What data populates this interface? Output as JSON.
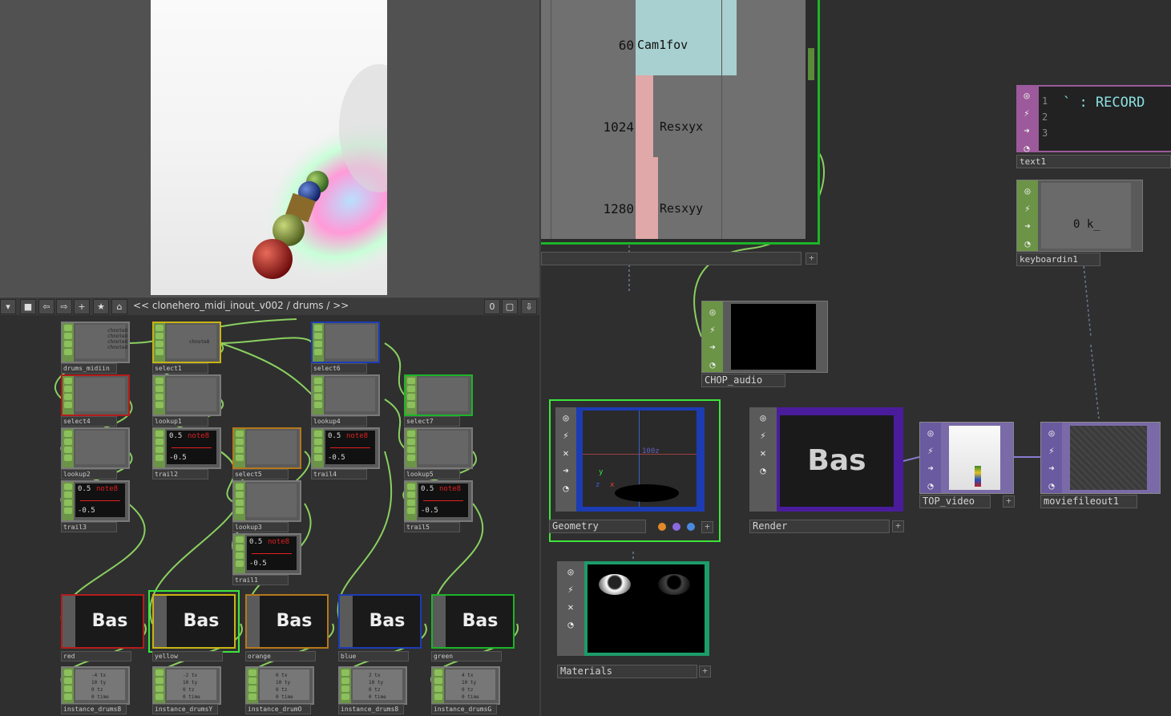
{
  "viewer": {
    "label": "render preview"
  },
  "toolbar": {
    "path": "<<  clonehero_midi_inout_v002 / drums / >>",
    "counter": "0",
    "buttons": [
      "▾",
      "■",
      "⇦",
      "⇨",
      "+",
      "★",
      "⌂"
    ]
  },
  "table": {
    "rows": [
      {
        "value": "60",
        "name": "Cam1fov"
      },
      {
        "value": "1024",
        "name": "Resxyx"
      },
      {
        "value": "1280",
        "name": "Resxyy"
      }
    ]
  },
  "left_nodes": {
    "drums_midiin": "drums_midiin",
    "select1": "select1",
    "select6": "select6",
    "select4": "select4",
    "lookup1": "lookup1",
    "lookup4": "lookup4",
    "select7": "select7",
    "lookup2": "lookup2",
    "trail2": "trail2",
    "select5": "select5",
    "trail4": "trail4",
    "lookup5": "lookup5",
    "trail3": "trail3",
    "lookup3": "lookup3",
    "trail5": "trail5",
    "trail1": "trail1",
    "chnote": "chnote8",
    "note_label": "note8",
    "trail_top": "0.5",
    "trail_mid": "0",
    "trail_bot": "-0.5"
  },
  "bas_nodes": [
    {
      "label": "red",
      "text": "Bas",
      "color": "#b41c1c"
    },
    {
      "label": "yellow",
      "text": "Bas",
      "color": "#c8b414"
    },
    {
      "label": "orange",
      "text": "Bas",
      "color": "#b4781c"
    },
    {
      "label": "blue",
      "text": "Bas",
      "color": "#1c3cb4"
    },
    {
      "label": "green",
      "text": "Bas",
      "color": "#1cb428"
    }
  ],
  "instance_nodes": [
    {
      "label": "instance_drums8",
      "tx": "-4",
      "ty": "10",
      "tz": "0",
      "time": "0"
    },
    {
      "label": "instance_drumsY",
      "tx": "-2",
      "ty": "10",
      "tz": "0",
      "time": "0"
    },
    {
      "label": "instance_drumO",
      "tx": "0",
      "ty": "10",
      "tz": "0",
      "time": "0"
    },
    {
      "label": "instance_drums8",
      "tx": "2",
      "ty": "10",
      "tz": "0",
      "time": "0"
    },
    {
      "label": "instance_drumsG",
      "tx": "4",
      "ty": "10",
      "tz": "0",
      "time": "0"
    }
  ],
  "instance_keys": {
    "tx": "tx",
    "ty": "ty",
    "tz": "tz",
    "time": "time"
  },
  "right_nodes": {
    "text1": {
      "label": "text1",
      "lines": [
        "1",
        "2",
        "3"
      ],
      "content": "` : RECORD"
    },
    "keyboardin1": {
      "label": "keyboardin1",
      "value": "0 k_"
    },
    "chop_audio": {
      "label": "CHOP_audio"
    },
    "geometry": {
      "label": "Geometry",
      "axis_text": "100z",
      "y": "y",
      "x": "x",
      "z": "z"
    },
    "render": {
      "label": "Render",
      "text": "Bas"
    },
    "top_video": {
      "label": "TOP_video"
    },
    "moviefileout1": {
      "label": "moviefileout1"
    },
    "materials": {
      "label": "Materials"
    }
  },
  "colors": {
    "chop_green": "#6b9447",
    "sop_blue": "#1c3cb4",
    "render_purple": "#4a1c9c",
    "top_purple": "#7a6aa8",
    "dat_pink": "#9c5a9c",
    "mat_teal": "#1c9c6a",
    "selected": "#3ce63c"
  }
}
